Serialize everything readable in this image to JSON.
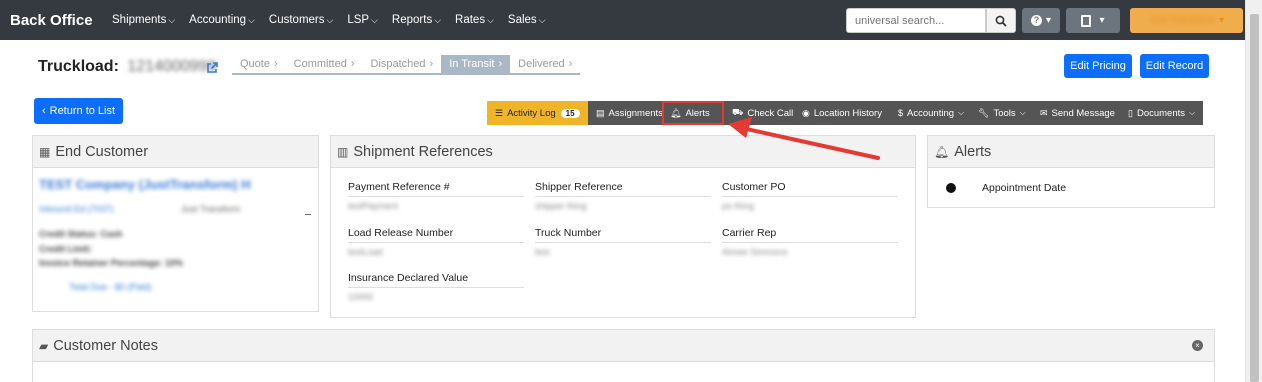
{
  "nav": {
    "brand": "Back Office",
    "items": [
      "Shipments",
      "Accounting",
      "Customers",
      "LSP",
      "Reports",
      "Rates",
      "Sales"
    ],
    "search_placeholder": "universal search...",
    "user": "Just Transform"
  },
  "header": {
    "title": "Truckload:",
    "load_number": "1214000999",
    "steps": [
      "Quote",
      "Committed",
      "Dispatched",
      "In Transit",
      "Delivered"
    ],
    "active_step": "In Transit",
    "edit_pricing": "Edit Pricing",
    "edit_record": "Edit Record",
    "return_to_list": "Return to List"
  },
  "tabs": [
    {
      "label": "Activity Log",
      "icon": "list-icon",
      "badge": "15"
    },
    {
      "label": "Assignments",
      "icon": "clipboard-icon"
    },
    {
      "label": "Alerts",
      "icon": "bell-icon"
    },
    {
      "label": "Check Call",
      "icon": "car-icon"
    },
    {
      "label": "Location History",
      "icon": "compass-icon"
    },
    {
      "label": "Accounting",
      "icon": "dollar-icon",
      "dropdown": true
    },
    {
      "label": "Tools",
      "icon": "wrench-icon",
      "dropdown": true
    },
    {
      "label": "Send Message",
      "icon": "envelope-icon"
    },
    {
      "label": "Documents",
      "icon": "file-icon",
      "dropdown": true
    }
  ],
  "end_customer": {
    "title": "End Customer",
    "company": "TEST Company (JustTransform) H",
    "contact": "Inbound Ed (7037)",
    "rep": "Just Transform",
    "lines": [
      "Credit Status: Cash",
      "Credit Limit:",
      "Invoice Retainer Percentage: 10%"
    ],
    "total_due": "Total Due - $0 (Paid)"
  },
  "shipment_refs": {
    "title": "Shipment References",
    "fields": [
      {
        "label": "Payment Reference #",
        "value": "testPayment"
      },
      {
        "label": "Shipper Reference",
        "value": "shipper thing"
      },
      {
        "label": "Customer PO",
        "value": "po thing"
      },
      {
        "label": "Load Release Number",
        "value": "testLoad"
      },
      {
        "label": "Truck Number",
        "value": "test"
      },
      {
        "label": "Carrier Rep",
        "value": "Aimee Simmons"
      },
      {
        "label": "Insurance Declared Value",
        "value": "10000"
      }
    ]
  },
  "alerts_panel": {
    "title": "Alerts",
    "items": [
      {
        "label": "Appointment Date",
        "icon": "clock-icon"
      }
    ]
  },
  "customer_notes": {
    "title": "Customer Notes"
  },
  "colors": {
    "nav_bg": "#343a40",
    "primary": "#0d6efd",
    "activity_tab": "#f0b429",
    "annotation": "#e53935"
  }
}
